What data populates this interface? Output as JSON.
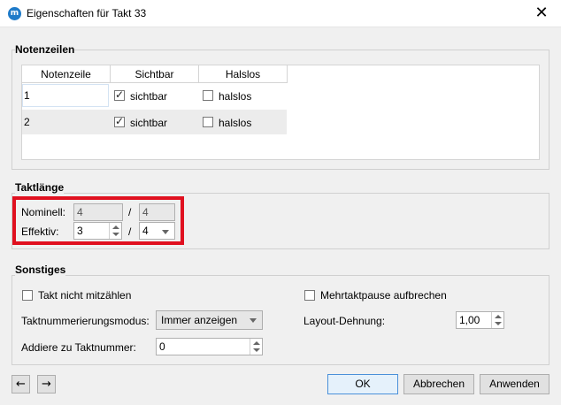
{
  "window": {
    "title": "Eigenschaften für Takt 33",
    "close_glyph": "✕",
    "app_icon_text": "m"
  },
  "staves": {
    "title": "Notenzeilen",
    "columns": [
      "Notenzeile",
      "Sichtbar",
      "Halslos"
    ],
    "rows": [
      {
        "number": "1",
        "visible": true,
        "visible_label": "sichtbar",
        "stemless": false,
        "stemless_label": "halslos"
      },
      {
        "number": "2",
        "visible": true,
        "visible_label": "sichtbar",
        "stemless": false,
        "stemless_label": "halslos"
      }
    ]
  },
  "measure_length": {
    "title": "Taktlänge",
    "nominal_label": "Nominell:",
    "nominal_numerator": "4",
    "nominal_denominator": "4",
    "actual_label": "Effektiv:",
    "actual_numerator": "3",
    "actual_denominator": "4",
    "separator": "/"
  },
  "other": {
    "title": "Sonstiges",
    "exclude_label": "Takt nicht mitzählen",
    "exclude_checked": false,
    "break_mmrest_label": "Mehrtaktpause aufbrechen",
    "break_mmrest_checked": false,
    "numbering_mode_label": "Taktnummerierungsmodus:",
    "numbering_mode_value": "Immer anzeigen",
    "layout_stretch_label": "Layout-Dehnung:",
    "layout_stretch_value": "1,00",
    "add_to_number_label": "Addiere zu Taktnummer:",
    "add_to_number_value": "0"
  },
  "footer": {
    "prev_glyph": "←",
    "next_glyph": "→",
    "ok": "OK",
    "cancel": "Abbrechen",
    "apply": "Anwenden"
  }
}
